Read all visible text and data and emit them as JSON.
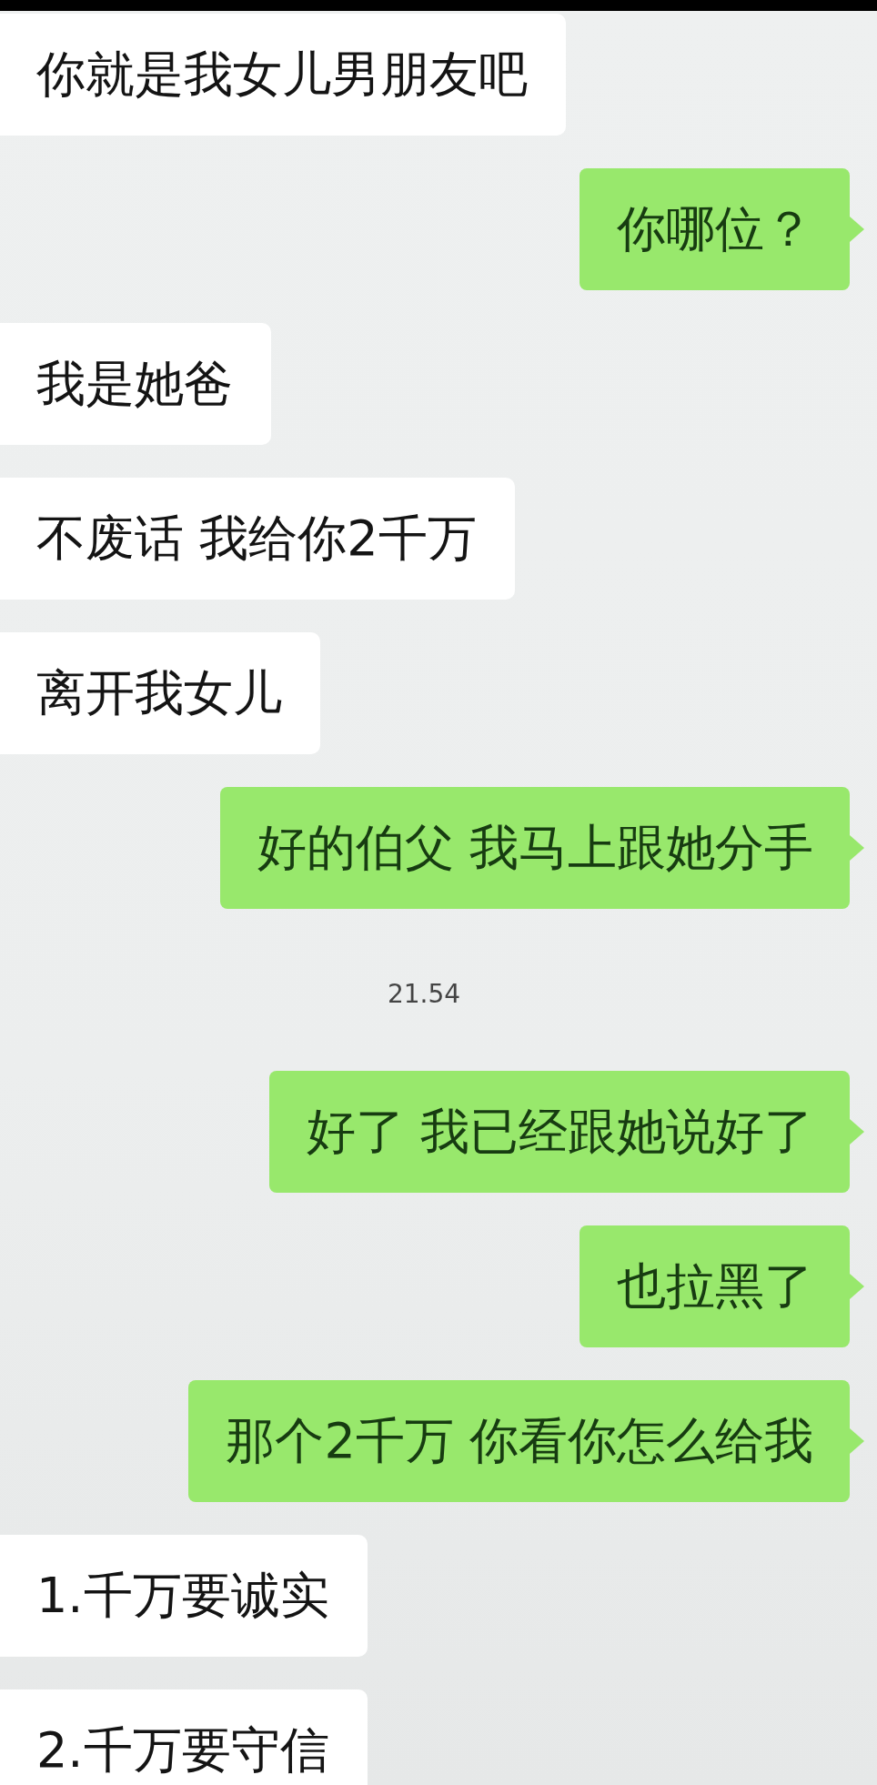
{
  "messages": [
    {
      "kind": "received",
      "text": "你就是我女儿男朋友吧"
    },
    {
      "kind": "sent",
      "text": "你哪位？"
    },
    {
      "kind": "received",
      "text": "我是她爸"
    },
    {
      "kind": "received",
      "text": "不废话 我给你2千万"
    },
    {
      "kind": "received",
      "text": "离开我女儿"
    },
    {
      "kind": "sent",
      "text": "好的伯父 我马上跟她分手"
    },
    {
      "kind": "time",
      "text": "21.54"
    },
    {
      "kind": "sent",
      "text": "好了 我已经跟她说好了"
    },
    {
      "kind": "sent",
      "text": "也拉黑了"
    },
    {
      "kind": "sent",
      "text": "那个2千万 你看你怎么给我"
    },
    {
      "kind": "received",
      "text": "1.千万要诚实"
    },
    {
      "kind": "received",
      "text": "2.千万要守信"
    }
  ]
}
